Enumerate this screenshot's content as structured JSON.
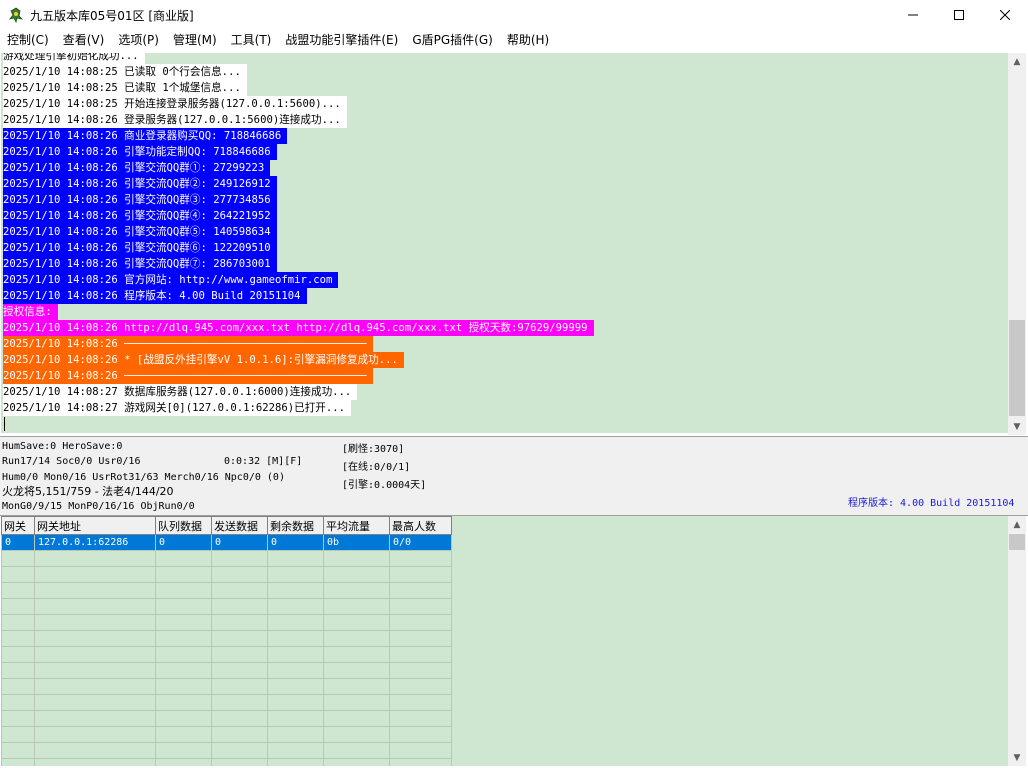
{
  "window": {
    "title": "九五版本库05号01区 [商业版]",
    "controls": {
      "minimize": "minimize",
      "maximize": "maximize",
      "close": "close"
    }
  },
  "menu": [
    "控制(C)",
    "查看(V)",
    "选项(P)",
    "管理(M)",
    "工具(T)",
    "战盟功能引擎插件(E)",
    "G盾PG插件(G)",
    "帮助(H)"
  ],
  "log": [
    {
      "text": "游戏处理引擎初始化成功...",
      "style": "white"
    },
    {
      "text": "2025/1/10 14:08:25 已读取 0个行会信息...",
      "style": "white"
    },
    {
      "text": "2025/1/10 14:08:25 已读取 1个城堡信息...",
      "style": "white"
    },
    {
      "text": "2025/1/10 14:08:25 开始连接登录服务器(127.0.0.1:5600)...",
      "style": "white"
    },
    {
      "text": "2025/1/10 14:08:26 登录服务器(127.0.0.1:5600)连接成功...",
      "style": "white"
    },
    {
      "text": "2025/1/10 14:08:26 商业登录器购买QQ: 718846686",
      "style": "blue"
    },
    {
      "text": "2025/1/10 14:08:26 引擎功能定制QQ: 718846686",
      "style": "blue"
    },
    {
      "text": "2025/1/10 14:08:26 引擎交流QQ群①: 27299223",
      "style": "blue"
    },
    {
      "text": "2025/1/10 14:08:26 引擎交流QQ群②: 249126912",
      "style": "blue"
    },
    {
      "text": "2025/1/10 14:08:26 引擎交流QQ群③: 277734856",
      "style": "blue"
    },
    {
      "text": "2025/1/10 14:08:26 引擎交流QQ群④: 264221952",
      "style": "blue"
    },
    {
      "text": "2025/1/10 14:08:26 引擎交流QQ群⑤: 140598634",
      "style": "blue"
    },
    {
      "text": "2025/1/10 14:08:26 引擎交流QQ群⑥: 122209510",
      "style": "blue"
    },
    {
      "text": "2025/1/10 14:08:26 引擎交流QQ群⑦: 286703001",
      "style": "blue"
    },
    {
      "text": "2025/1/10 14:08:26 官方网站: http://www.gameofmir.com",
      "style": "blue"
    },
    {
      "text": "2025/1/10 14:08:26 程序版本: 4.00 Build 20151104",
      "style": "blue"
    },
    {
      "text": "授权信息:",
      "style": "magenta"
    },
    {
      "text": "2025/1/10 14:08:26 http://dlq.945.com/xxx.txt http://dlq.945.com/xxx.txt 授权天数:97629/99999",
      "style": "magenta"
    },
    {
      "text": "2025/1/10 14:08:26 ──────────────────────────────────────",
      "style": "orange"
    },
    {
      "text": "2025/1/10 14:08:26 * [战盟反外挂引擎vV 1.0.1.6]:引擎漏洞修复成功...",
      "style": "orange"
    },
    {
      "text": "2025/1/10 14:08:26 ──────────────────────────────────────",
      "style": "orange"
    },
    {
      "text": "2025/1/10 14:08:27 数据库服务器(127.0.0.1:6000)连接成功...",
      "style": "white"
    },
    {
      "text": "2025/1/10 14:08:27 游戏网关[0](127.0.0.1:62286)已打开...",
      "style": "white"
    }
  ],
  "status": {
    "line1": "HumSave:0 HeroSave:0",
    "line2": "Run17/14 Soc0/0 Usr0/16",
    "timer": "0:0:32 [M][F]",
    "line3": "Hum0/0 Mon0/16 UsrRot31/63 Merch0/16 Npc0/0 (0)",
    "line4": "火龙将5,151/759 - 法老4/144/20",
    "line5": "MonG0/9/15 MonP0/16/16 ObjRun0/0",
    "refresh": "[刷怪:3070]",
    "online": "[在线:0/0/1]",
    "engine": "[引擎:0.0004天]",
    "version": "程序版本: 4.00 Build 20151104"
  },
  "grid": {
    "columns": [
      "网关",
      "网关地址",
      "队列数据",
      "发送数据",
      "剩余数据",
      "平均流量",
      "最高人数"
    ],
    "rows": [
      [
        "0",
        "127.0.0.1:62286",
        "0",
        "0",
        "0",
        "0b",
        "0/0"
      ]
    ],
    "empty_rows": 14
  },
  "colors": {
    "log_bg": "#cfe7d0",
    "blue": "#0000ff",
    "magenta": "#ff00ff",
    "orange": "#ff6600",
    "selection": "#0078d7",
    "version_text": "#1a1ad8"
  }
}
